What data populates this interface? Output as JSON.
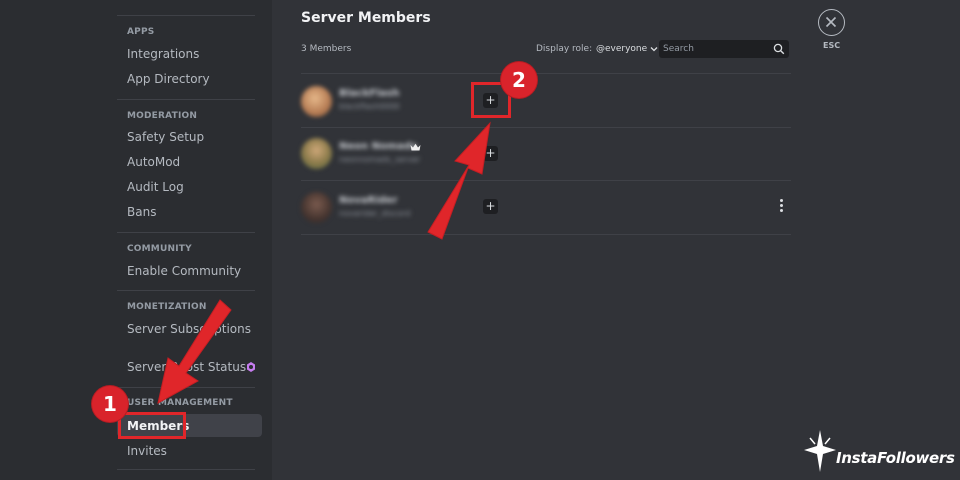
{
  "sidebar": {
    "sections": [
      {
        "header": "APPS",
        "items": [
          "Integrations",
          "App Directory"
        ]
      },
      {
        "header": "MODERATION",
        "items": [
          "Safety Setup",
          "AutoMod",
          "Audit Log",
          "Bans"
        ]
      },
      {
        "header": "COMMUNITY",
        "items": [
          "Enable Community"
        ]
      },
      {
        "header": "MONETIZATION",
        "items": [
          "Server Subscriptions",
          "Server Boost Status"
        ]
      },
      {
        "header": "USER MANAGEMENT",
        "items": [
          "Members",
          "Invites"
        ]
      }
    ],
    "active_item": "Members"
  },
  "main": {
    "title": "Server Members",
    "member_count": "3 Members",
    "display_role_label": "Display role:",
    "display_role_value": "@everyone",
    "search_placeholder": "Search",
    "members": [
      {
        "name": "BlackFlash",
        "subtitle": "blackflash0000",
        "owner": false
      },
      {
        "name": "Neon Nomads",
        "subtitle": "neonnomads_server",
        "owner": true
      },
      {
        "name": "NovaRider",
        "subtitle": "novarider_discord",
        "owner": false
      }
    ]
  },
  "close": {
    "label": "ESC"
  },
  "annotations": {
    "step1": "1",
    "step2": "2",
    "color": "#e0262a"
  },
  "brand": {
    "name": "InstaFollowers"
  },
  "colors": {
    "background": "#313338",
    "sidebar": "#2b2d31",
    "input": "#1e1f22",
    "boost": "#c67cf0"
  }
}
